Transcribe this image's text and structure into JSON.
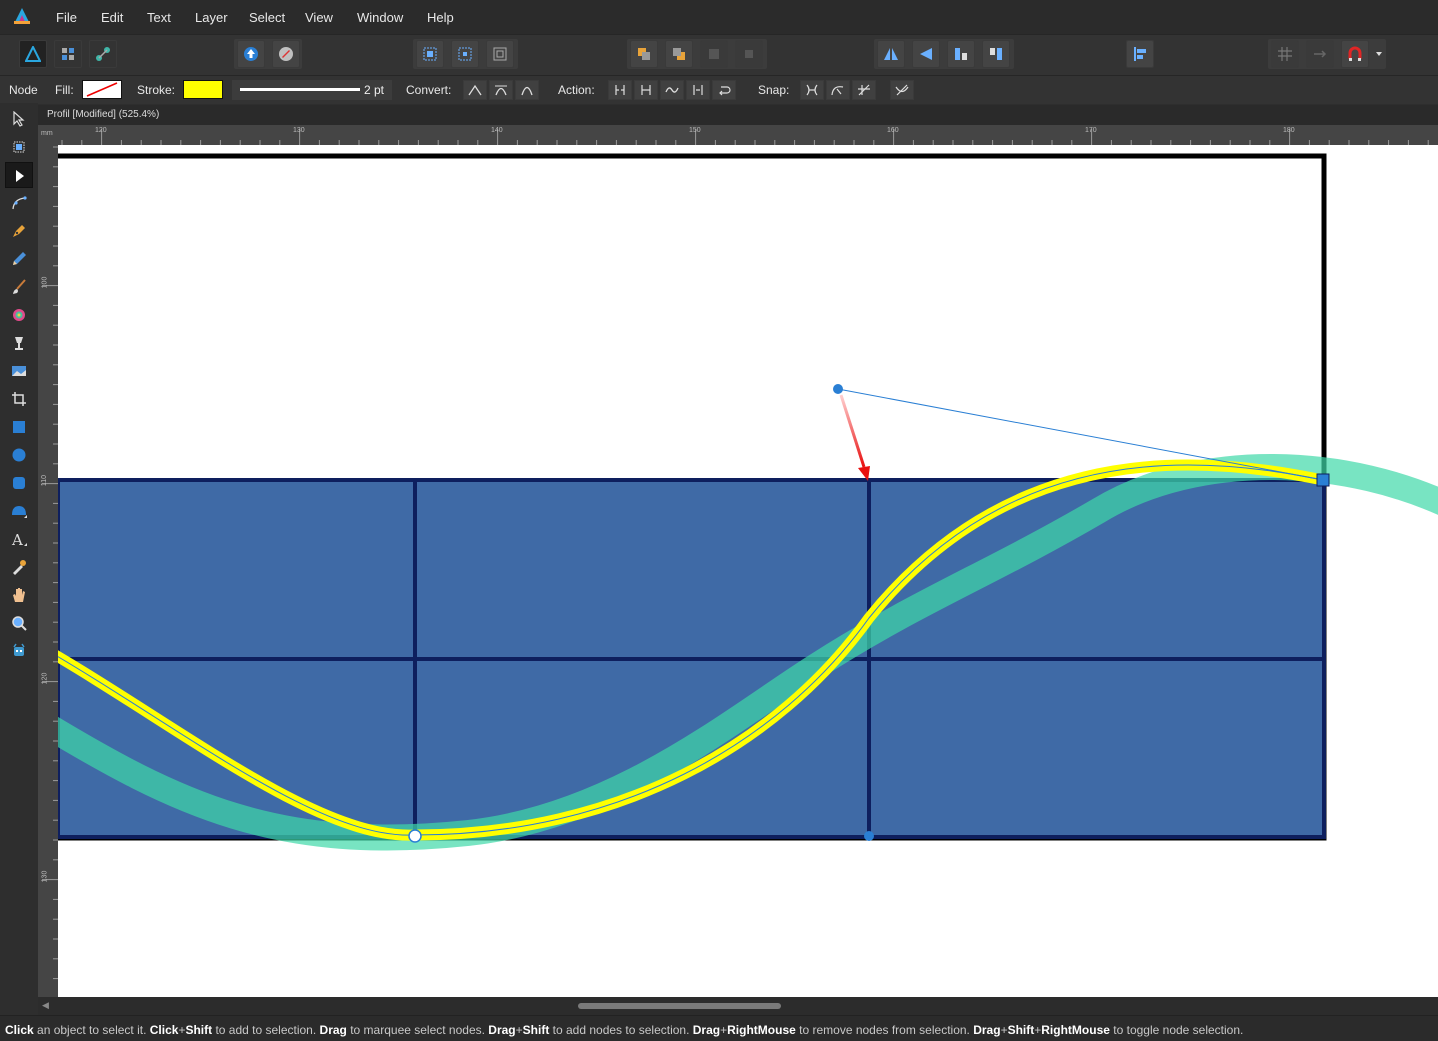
{
  "menu": {
    "items": [
      "File",
      "Edit",
      "Text",
      "Layer",
      "Select",
      "View",
      "Window",
      "Help"
    ]
  },
  "context": {
    "tool_name": "Node",
    "fill_label": "Fill:",
    "stroke_label": "Stroke:",
    "stroke_color": "#ffff00",
    "stroke_width": "2 pt",
    "convert_label": "Convert:",
    "action_label": "Action:",
    "snap_label": "Snap:"
  },
  "document": {
    "tab_title": "Profil [Modified] (525.4%)"
  },
  "ruler": {
    "unit": "mm",
    "h_ticks": [
      "120",
      "130",
      "140",
      "150",
      "160",
      "170",
      "180"
    ],
    "v_ticks": [
      "100",
      "110",
      "120",
      "130"
    ]
  },
  "colors": {
    "accent": "#2a7fd4",
    "grid_fill": "#3f6aa6",
    "grid_line": "#0e1f5e",
    "curve_stroke": "#ffff00",
    "shadow_curve": "#3fd8a8",
    "arrow": "#e81010"
  },
  "icons": {
    "app": "affinity-designer-logo-icon",
    "tools": [
      "move-tool-icon",
      "artboard-tool-icon",
      "node-tool-icon",
      "point-transform-icon",
      "pen-tool-icon",
      "pencil-tool-icon",
      "brush-tool-icon",
      "fill-tool-icon",
      "transparency-tool-icon",
      "place-image-icon",
      "crop-tool-icon",
      "rectangle-tool-icon",
      "ellipse-tool-icon",
      "rounded-rect-tool-icon",
      "shape-tool-icon",
      "text-tool-icon",
      "color-picker-icon",
      "hand-tool-icon",
      "zoom-tool-icon",
      "assistant-icon"
    ]
  },
  "status": {
    "segments": [
      {
        "t": "Click",
        "b": true
      },
      {
        "t": " an object to select it. ",
        "b": false
      },
      {
        "t": "Click",
        "b": true
      },
      {
        "t": "+",
        "b": false
      },
      {
        "t": "Shift",
        "b": true
      },
      {
        "t": " to add to selection. ",
        "b": false
      },
      {
        "t": "Drag",
        "b": true
      },
      {
        "t": " to marquee select nodes. ",
        "b": false
      },
      {
        "t": "Drag",
        "b": true
      },
      {
        "t": "+",
        "b": false
      },
      {
        "t": "Shift",
        "b": true
      },
      {
        "t": " to add nodes to selection. ",
        "b": false
      },
      {
        "t": "Drag",
        "b": true
      },
      {
        "t": "+",
        "b": false
      },
      {
        "t": "RightMouse",
        "b": true
      },
      {
        "t": " to remove nodes from selection. ",
        "b": false
      },
      {
        "t": "Drag",
        "b": true
      },
      {
        "t": "+",
        "b": false
      },
      {
        "t": "Shift",
        "b": true
      },
      {
        "t": "+",
        "b": false
      },
      {
        "t": "RightMouse",
        "b": true
      },
      {
        "t": " to toggle node selection.",
        "b": false
      }
    ]
  }
}
